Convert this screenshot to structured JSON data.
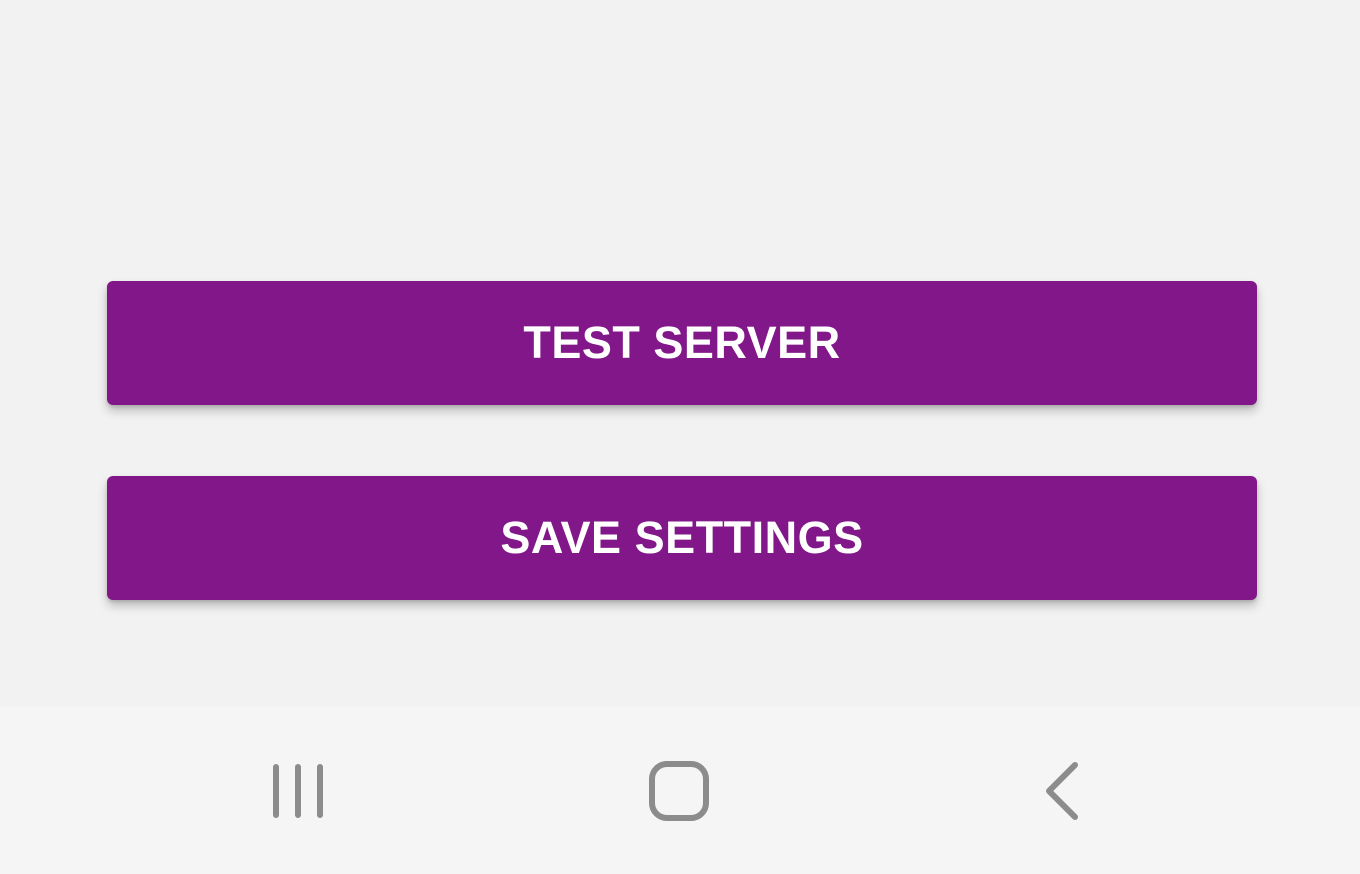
{
  "buttons": {
    "test_server": "TEST SERVER",
    "save_settings": "SAVE SETTINGS"
  },
  "colors": {
    "button_background": "#82178a",
    "button_text": "#ffffff",
    "screen_background": "#f2f2f2",
    "nav_bar_background": "#f5f5f5",
    "nav_icon": "#8c8c8c"
  },
  "navigation_bar": {
    "icons": [
      "recent-apps-icon",
      "home-icon",
      "back-icon"
    ]
  }
}
